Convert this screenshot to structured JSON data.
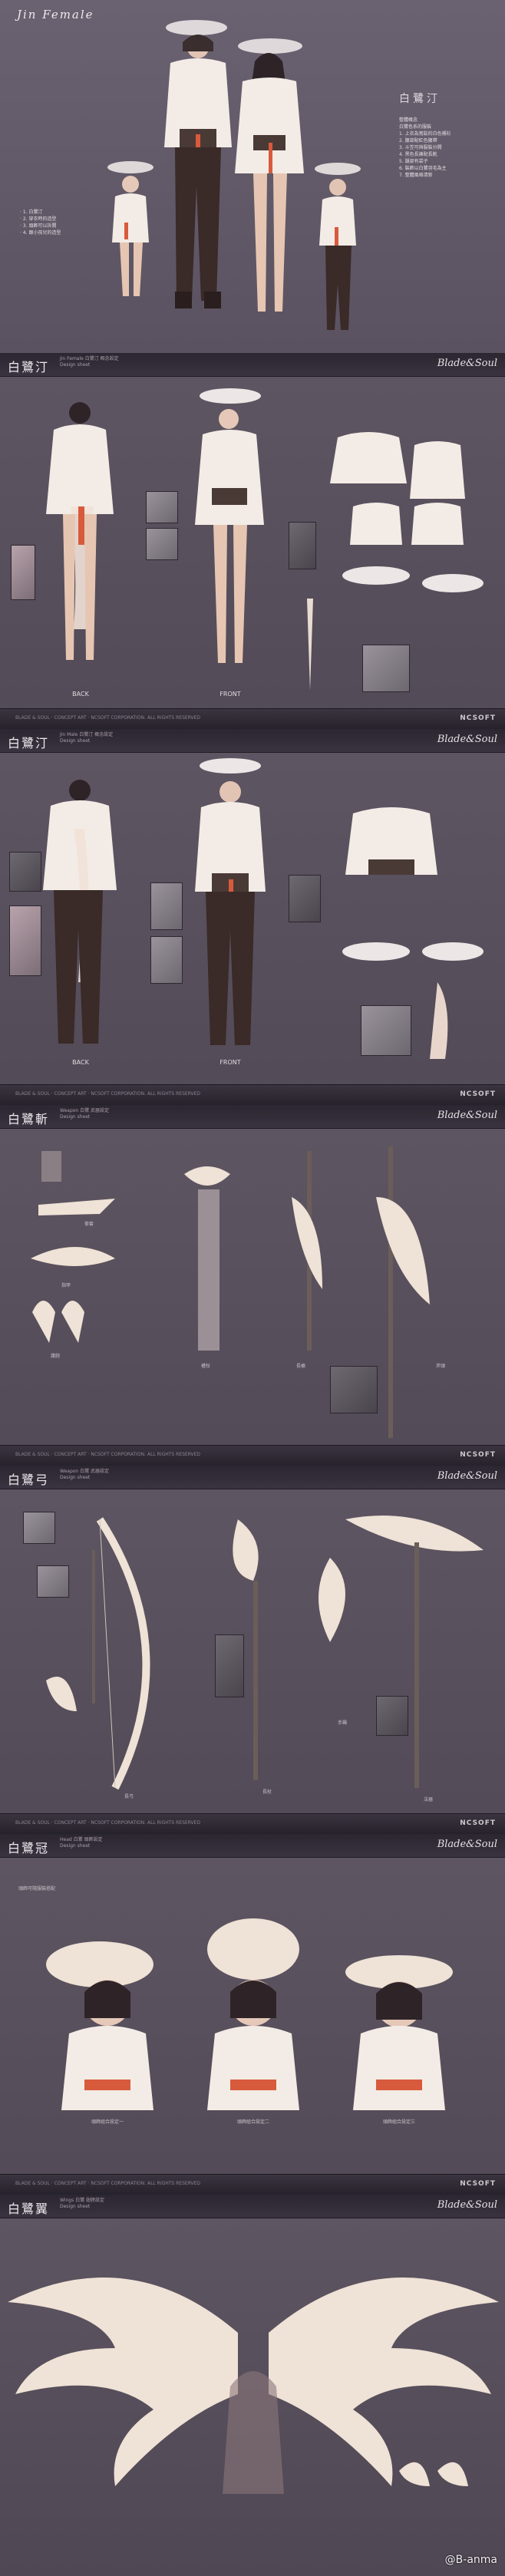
{
  "colors": {
    "background": "#5d5560",
    "header": "#2b2630",
    "cloth": "#f3ece6",
    "sash_red": "#d85a3c",
    "dark_pants": "#3a2a28",
    "ornament": "#efe2d6"
  },
  "page1": {
    "title": "Jin Female",
    "name_label": "白鷺汀",
    "notes_left": [
      "· 1. 白鷺汀",
      "· 2. 穿衣時的造型",
      "· 3. 頭飾可以拆開",
      "· 4. 跟小孩兒的造型"
    ],
    "notes_right": [
      "整體概念",
      "白鷺色系的服裝",
      "1. 上衣為寬鬆的白色襯衫",
      "2. 腰部配紅色腰帶",
      "3. 斗笠可與服裝分開",
      "4. 黑色長褲配長靴",
      "5. 腿部有袋子",
      "6. 裝飾以白鷺羽毛為主",
      "7. 整體風格清新"
    ]
  },
  "sheets": [
    {
      "id": "p2",
      "title": "白鷺汀",
      "subtitle_lines": [
        "Jin Female  白鷺汀 概念設定",
        "Design sheet"
      ],
      "back_label": "BACK",
      "front_label": "FRONT"
    },
    {
      "id": "p3",
      "title": "白鷺汀",
      "subtitle_lines": [
        "Jin Male  白鷺汀 概念設定",
        "Design sheet"
      ],
      "back_label": "BACK",
      "front_label": "FRONT"
    },
    {
      "id": "p4",
      "title": "白鷺斬",
      "subtitle_lines": [
        "Weapon  白鷺 武器設定",
        "Design sheet"
      ],
      "labels": [
        "拳套",
        "指甲",
        "護腕",
        "權杖",
        "長槍",
        "斧頭"
      ]
    },
    {
      "id": "p5",
      "title": "白鷺弓",
      "subtitle_lines": [
        "Weapon  白鷺 武器設定",
        "Design sheet"
      ],
      "labels": [
        "長弓",
        "長杖",
        "手鐲",
        "法器"
      ]
    },
    {
      "id": "p6",
      "title": "白鷺冠",
      "subtitle_lines": [
        "Head  白鷺 頭飾設定",
        "Design sheet"
      ],
      "intro": "頭飾可隨服裝搭配",
      "labels": [
        "頭飾組合設定一",
        "頭飾組合設定二",
        "頭飾組合設定三"
      ]
    },
    {
      "id": "p7",
      "title": "白鷺翼",
      "subtitle_lines": [
        "Wings  白鷺 翅膀設定",
        "Design sheet"
      ]
    }
  ],
  "logo": "Blade&Soul",
  "footer_text": "BLADE & SOUL · CONCEPT ART · NCSOFT CORPORATION. ALL RIGHTS RESERVED",
  "footer_brand": "NCSOFT",
  "watermark": "@B-anma"
}
